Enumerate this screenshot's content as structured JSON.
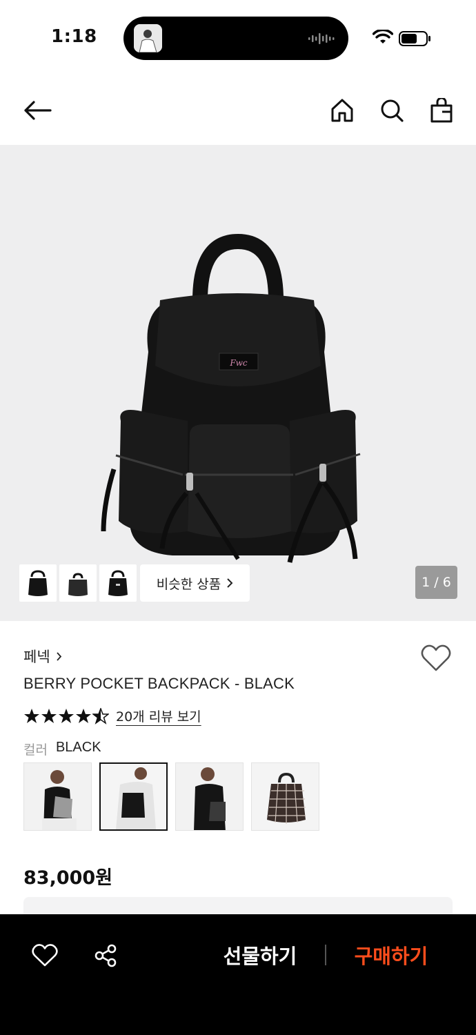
{
  "status_bar": {
    "time": "1:18"
  },
  "hero": {
    "similar_label": "비슷한 상품",
    "page_counter": "1 / 6"
  },
  "product": {
    "brand": "페넥",
    "name": "BERRY POCKET BACKPACK - BLACK",
    "rating": 4.5,
    "review_link": "20개 리뷰 보기",
    "color_label": "컬러",
    "color_value": "BLACK",
    "price": "83,000원",
    "selected_swatch_index": 1
  },
  "bottom_bar": {
    "gift_label": "선물하기",
    "buy_label": "구매하기"
  },
  "colors": {
    "accent": "#ff4d1c",
    "hero_bg": "#eeeeef",
    "bottom_bg": "#000000"
  }
}
